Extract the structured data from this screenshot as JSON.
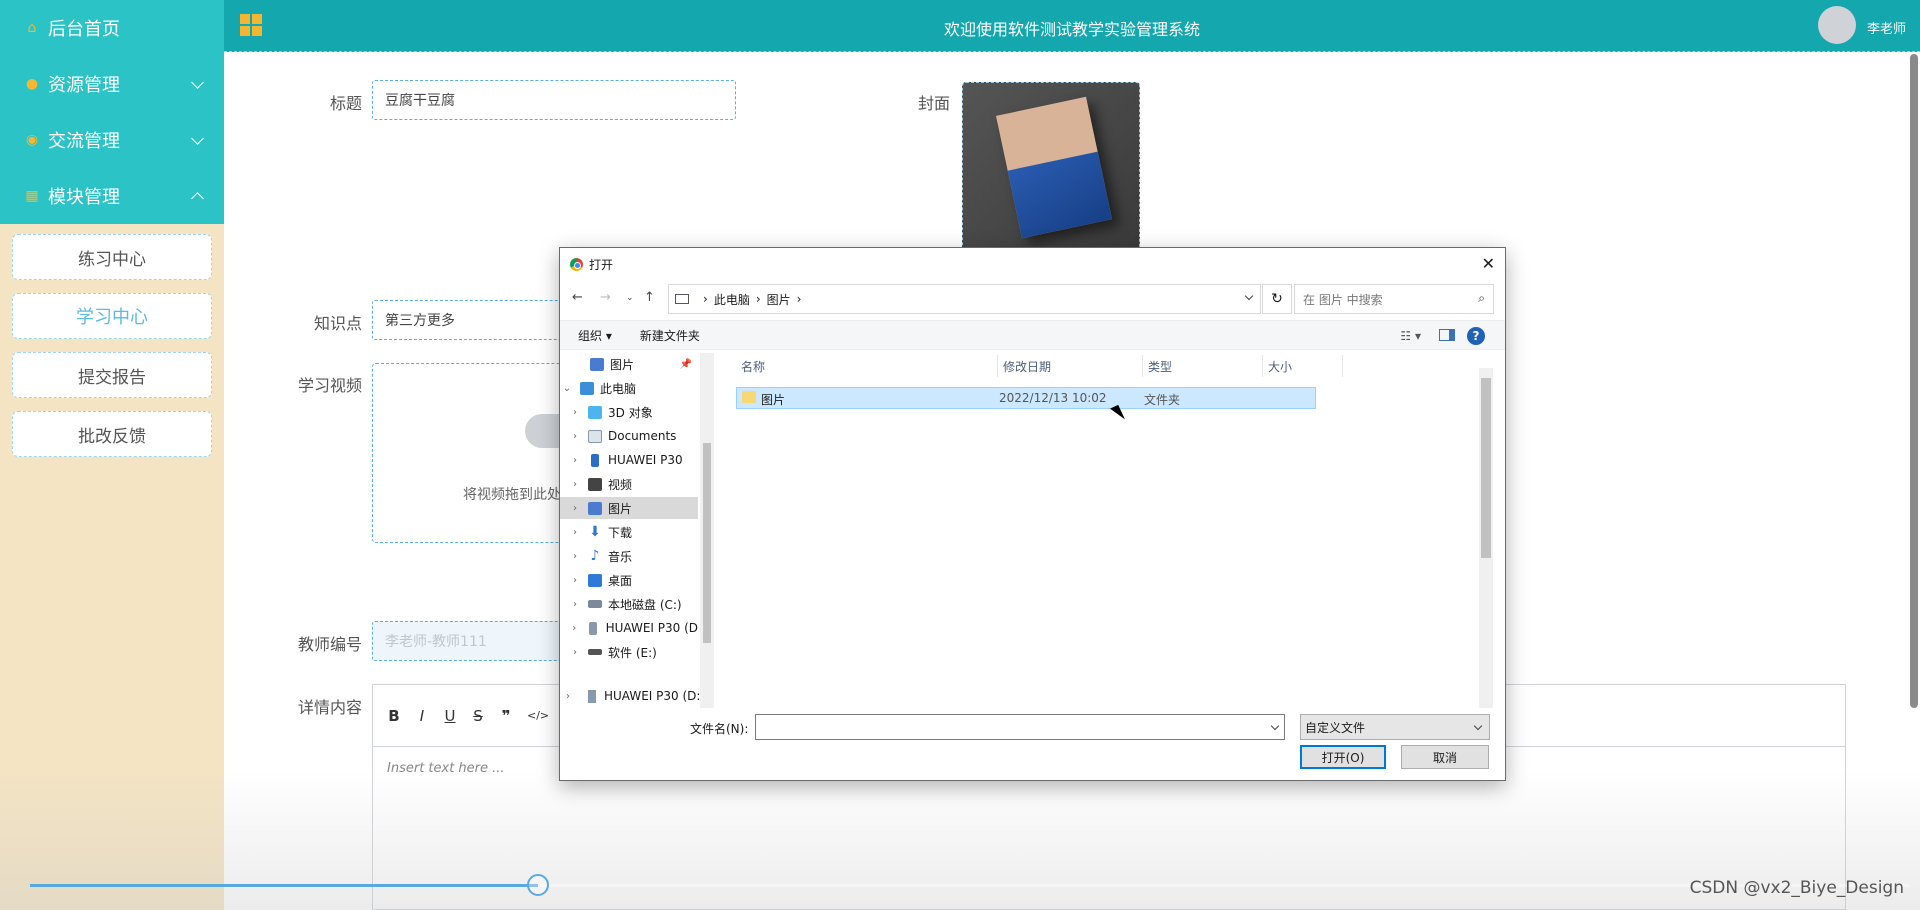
{
  "sidebar": {
    "items": [
      {
        "label": "后台首页",
        "icon": "home-icon"
      },
      {
        "label": "资源管理",
        "icon": "location-icon"
      },
      {
        "label": "交流管理",
        "icon": "chat-icon"
      },
      {
        "label": "模块管理",
        "icon": "grid-icon"
      }
    ],
    "sub_items": [
      "练习中心",
      "学习中心",
      "提交报告",
      "批改反馈"
    ],
    "active_sub": "学习中心"
  },
  "header": {
    "title": "欢迎使用软件测试教学实验管理系统",
    "user": "李老师"
  },
  "form": {
    "title_label": "标题",
    "title_value": "豆腐干豆腐",
    "cover_label": "封面",
    "knowledge_label": "知识点",
    "knowledge_value": "第三方更多",
    "video_label": "学习视频",
    "upload_text": "将视频拖到此处",
    "teacher_label": "教师编号",
    "teacher_value": "李老师-教师111",
    "detail_label": "详情内容",
    "editor_placeholder": "Insert text here ..."
  },
  "dialog": {
    "title": "打开",
    "breadcrumb": [
      "此电脑",
      "图片"
    ],
    "search_placeholder": "在 图片 中搜索",
    "organize": "组织 ▾",
    "new_folder": "新建文件夹",
    "tree": [
      {
        "label": "图片",
        "icon": "pictures-icon",
        "pinned": true
      },
      {
        "label": "此电脑",
        "icon": "computer-icon",
        "expanded": true
      },
      {
        "label": "3D 对象",
        "icon": "3d-icon"
      },
      {
        "label": "Documents",
        "icon": "document-icon"
      },
      {
        "label": "HUAWEI P30",
        "icon": "phone-icon"
      },
      {
        "label": "视频",
        "icon": "video-icon"
      },
      {
        "label": "图片",
        "icon": "pictures-icon",
        "selected": true
      },
      {
        "label": "下载",
        "icon": "download-icon"
      },
      {
        "label": "音乐",
        "icon": "music-icon"
      },
      {
        "label": "桌面",
        "icon": "desktop-icon"
      },
      {
        "label": "本地磁盘 (C:)",
        "icon": "drive-icon"
      },
      {
        "label": "HUAWEI P30 (D",
        "icon": "phone-icon"
      },
      {
        "label": "软件 (E:)",
        "icon": "drive-icon"
      }
    ],
    "tree_bottom": "HUAWEI P30 (D:",
    "columns": [
      "名称",
      "修改日期",
      "类型",
      "大小"
    ],
    "files": [
      {
        "name": "图片",
        "date": "2022/12/13 10:02",
        "type": "文件夹",
        "size": ""
      }
    ],
    "filename_label": "文件名(N):",
    "filetype": "自定义文件",
    "open_button": "打开(O)",
    "cancel_button": "取消"
  },
  "player": {
    "progress": 0.27,
    "watermark": "CSDN @vx2_Biye_Design"
  }
}
